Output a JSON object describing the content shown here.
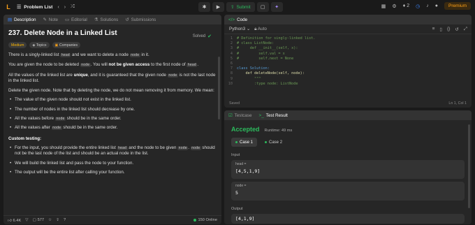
{
  "topbar": {
    "logo": "L",
    "problem_list": "Problem List",
    "run": "Run",
    "run_shortcut": "Ctrl",
    "submit": "Submit",
    "streak": "2",
    "premium": "Premium"
  },
  "desc_tabs": [
    {
      "label": "Description",
      "icon": "document-icon"
    },
    {
      "label": "Note",
      "icon": "note-icon"
    },
    {
      "label": "Editorial",
      "icon": "book-icon"
    },
    {
      "label": "Solutions",
      "icon": "flask-icon"
    },
    {
      "label": "Submissions",
      "icon": "history-icon"
    }
  ],
  "problem": {
    "title": "237. Delete Node in a Linked List",
    "solved": "Solved",
    "difficulty": "Medium",
    "topics": "Topics",
    "companies": "Companies",
    "p1": [
      "There is a singly-linked list ",
      "head",
      " and we want to delete a node ",
      "node",
      " in it."
    ],
    "p2": [
      "You are given the node to be deleted ",
      "node",
      ". You will ",
      "not be given access",
      " to the first node of ",
      "head",
      "."
    ],
    "p3": [
      "All the values of the linked list are ",
      "unique",
      ", and it is guaranteed that the given node ",
      "node",
      " is not the last node in the linked list."
    ],
    "p4": [
      "Delete the given node. Note that by deleting the node, we do not mean removing it from memory. We mean:"
    ],
    "bullets": [
      [
        "The value of the given node should not exist in the linked list."
      ],
      [
        "The number of nodes in the linked list should decrease by one."
      ],
      [
        "All the values before ",
        "node",
        " should be in the same order."
      ],
      [
        "All the values after ",
        "node",
        " should be in the same order."
      ]
    ],
    "custom_testing": "Custom testing:",
    "custom_bullets": [
      [
        "For the input, you should provide the entire linked list ",
        "head",
        " and the node to be given ",
        "node",
        ". ",
        "node",
        " should not be the last node of the list and should be an actual node in the list."
      ],
      [
        "We will build the linked list and pass the node to your function."
      ],
      [
        "The output will be the entire list after calling your function."
      ]
    ]
  },
  "desc_footer": {
    "likes": "6.4K",
    "comments": "577",
    "online": "150 Online"
  },
  "code_panel": {
    "tab": "Code",
    "language": "Python3",
    "mode": "Auto",
    "saved": "Saved",
    "cursor": "Ln 1, Col 1",
    "lines": [
      {
        "n": "1",
        "t": "# Definition for singly-linked list.",
        "c": "cm"
      },
      {
        "n": "2",
        "t": "# class ListNode:",
        "c": "cm"
      },
      {
        "n": "3",
        "t": "#     def __init__(self, x):",
        "c": "cm"
      },
      {
        "n": "4",
        "t": "#         self.val = x",
        "c": "cm"
      },
      {
        "n": "5",
        "t": "#         self.next = None",
        "c": "cm"
      },
      {
        "n": "6",
        "t": "",
        "c": ""
      },
      {
        "n": "7",
        "t": "class Solution:",
        "c": "kw"
      },
      {
        "n": "8",
        "t": "    def deleteNode(self, node):",
        "c": "fn"
      },
      {
        "n": "9",
        "t": "        \"\"\"",
        "c": "cm"
      },
      {
        "n": "10",
        "t": "        :type node: ListNode",
        "c": "cm"
      }
    ]
  },
  "result_panel": {
    "tab_testcase": "Testcase",
    "tab_result": "Test Result",
    "status": "Accepted",
    "runtime": "Runtime: 49 ms",
    "case1": "Case 1",
    "case2": "Case 2",
    "input_label": "Input",
    "head_key": "head =",
    "head_val": "[4,5,1,9]",
    "node_key": "node =",
    "node_val": "5",
    "output_label": "Output",
    "output_val": "[4,1,9]"
  },
  "colors": {
    "accent": "#ffa116",
    "success": "#2cbb5d",
    "medium": "#ffb800"
  }
}
